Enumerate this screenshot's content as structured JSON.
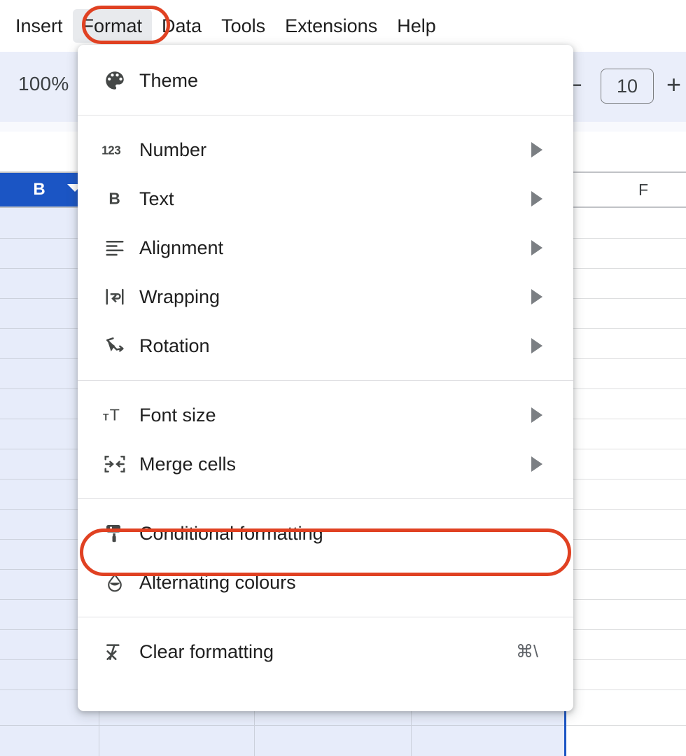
{
  "app": {
    "name": "Google Sheets",
    "accent_blue": "#1b55c4",
    "highlight_red": "#e04122",
    "selection_fill": "#e7ecfa"
  },
  "menubar": {
    "items": [
      {
        "label": "Insert",
        "active": false
      },
      {
        "label": "Format",
        "active": true
      },
      {
        "label": "Data",
        "active": false
      },
      {
        "label": "Tools",
        "active": false
      },
      {
        "label": "Extensions",
        "active": false
      },
      {
        "label": "Help",
        "active": false
      }
    ]
  },
  "toolbar": {
    "zoom_level": "100%",
    "font_size_decrease": "−",
    "font_size_value": "10",
    "font_size_increase": "+"
  },
  "grid": {
    "selected_column_header": "B",
    "visible_column_header": "F"
  },
  "format_menu": {
    "groups": [
      {
        "items": [
          {
            "label": "Theme",
            "icon": "palette-icon",
            "submenu": false,
            "shortcut": "",
            "highlighted": false
          }
        ]
      },
      {
        "items": [
          {
            "label": "Number",
            "icon": "number-123-icon",
            "submenu": true,
            "shortcut": "",
            "highlighted": false
          },
          {
            "label": "Text",
            "icon": "bold-b-icon",
            "submenu": true,
            "shortcut": "",
            "highlighted": false
          },
          {
            "label": "Alignment",
            "icon": "align-left-icon",
            "submenu": true,
            "shortcut": "",
            "highlighted": false
          },
          {
            "label": "Wrapping",
            "icon": "text-wrap-icon",
            "submenu": true,
            "shortcut": "",
            "highlighted": false
          },
          {
            "label": "Rotation",
            "icon": "text-rotation-icon",
            "submenu": true,
            "shortcut": "",
            "highlighted": false
          }
        ]
      },
      {
        "items": [
          {
            "label": "Font size",
            "icon": "font-size-icon",
            "submenu": true,
            "shortcut": "",
            "highlighted": false
          },
          {
            "label": "Merge cells",
            "icon": "merge-cells-icon",
            "submenu": true,
            "shortcut": "",
            "highlighted": false
          }
        ]
      },
      {
        "items": [
          {
            "label": "Conditional formatting",
            "icon": "paint-roller-icon",
            "submenu": false,
            "shortcut": "",
            "highlighted": true
          },
          {
            "label": "Alternating colours",
            "icon": "water-drop-icon",
            "submenu": false,
            "shortcut": "",
            "highlighted": false
          }
        ]
      },
      {
        "items": [
          {
            "label": "Clear formatting",
            "icon": "clear-formatting-icon",
            "submenu": false,
            "shortcut": "⌘\\",
            "highlighted": false
          }
        ]
      }
    ]
  }
}
